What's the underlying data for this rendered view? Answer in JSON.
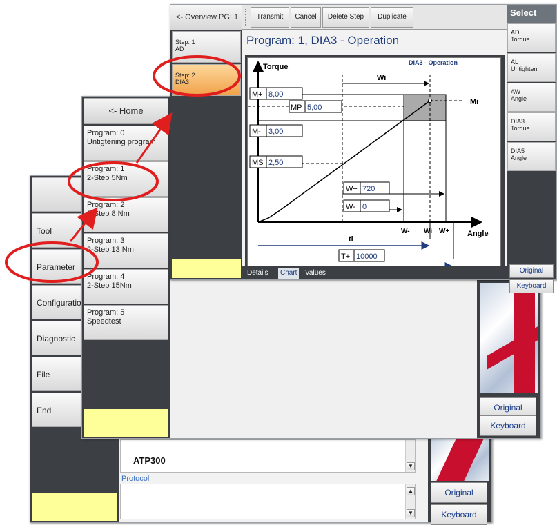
{
  "window1": {
    "menu": [
      {
        "label": "Tool"
      },
      {
        "label": "Parameter"
      },
      {
        "label": "Configuration"
      },
      {
        "label": "Diagnostic"
      },
      {
        "label": "File"
      },
      {
        "label": "End"
      }
    ],
    "device_name": "ATP300",
    "protocol_label": "Protocol",
    "original_label": "Original",
    "keyboard_label": "Keyboard"
  },
  "window2": {
    "home_label": "<- Home",
    "programs": [
      {
        "title": "Program: 0",
        "name": "Untigtening program"
      },
      {
        "title": "Program: 1",
        "name": "2-Step 5Nm"
      },
      {
        "title": "Program: 2",
        "name": "2-Step 8 Nm"
      },
      {
        "title": "Program: 3",
        "name": "2-Step 13 Nm"
      },
      {
        "title": "Program: 4",
        "name": "2-Step 15Nm"
      },
      {
        "title": "Program: 5",
        "name": "Speedtest"
      }
    ],
    "original_label": "Original",
    "keyboard_label": "Keyboard"
  },
  "window3": {
    "overview_label": "<- Overview PG: 1",
    "toolbar": [
      "Transmit",
      "Cancel",
      "Delete Step",
      "Duplicate"
    ],
    "steps": [
      {
        "title": "Step: 1",
        "name": "AD"
      },
      {
        "title": "Step: 2",
        "name": "DIA3"
      }
    ],
    "program_title": "Program: 1, DIA3 - Operation",
    "tabs": [
      "Details",
      "Chart",
      "Values"
    ],
    "active_tab": "Chart",
    "select_title": "Select",
    "select_items": [
      {
        "code": "AD",
        "desc": "Torque"
      },
      {
        "code": "AL",
        "desc": "Untighten"
      },
      {
        "code": "AW",
        "desc": "Angle"
      },
      {
        "code": "DIA3",
        "desc": "Torque"
      },
      {
        "code": "DIA5",
        "desc": "Angle"
      }
    ],
    "original_label": "Original",
    "keyboard_label": "Keyboard"
  },
  "chart_data": {
    "type": "line",
    "title": "DIA3 - Operation",
    "ylabel": "Torque",
    "xlabel": "Angle",
    "window_label": "Wi",
    "moment_label": "Mi",
    "time_label": "ti",
    "torque_params": [
      {
        "label": "M+",
        "value": "8,00"
      },
      {
        "label": "MP",
        "value": "5,00"
      },
      {
        "label": "M-",
        "value": "3,00"
      },
      {
        "label": "MS",
        "value": "2,50"
      }
    ],
    "angle_params": [
      {
        "label": "W+",
        "value": "720"
      },
      {
        "label": "W-",
        "value": "0"
      }
    ],
    "time_param": {
      "label": "T+",
      "value": "10000"
    },
    "x_ticks": [
      "W-",
      "Wi",
      "W+"
    ]
  },
  "colors": {
    "panel_dark": "#3c4045",
    "highlight_red": "#e01e1e",
    "title_blue": "#1f3d7a",
    "step_active": "#f0a24a",
    "yellow": "#ffff99"
  }
}
